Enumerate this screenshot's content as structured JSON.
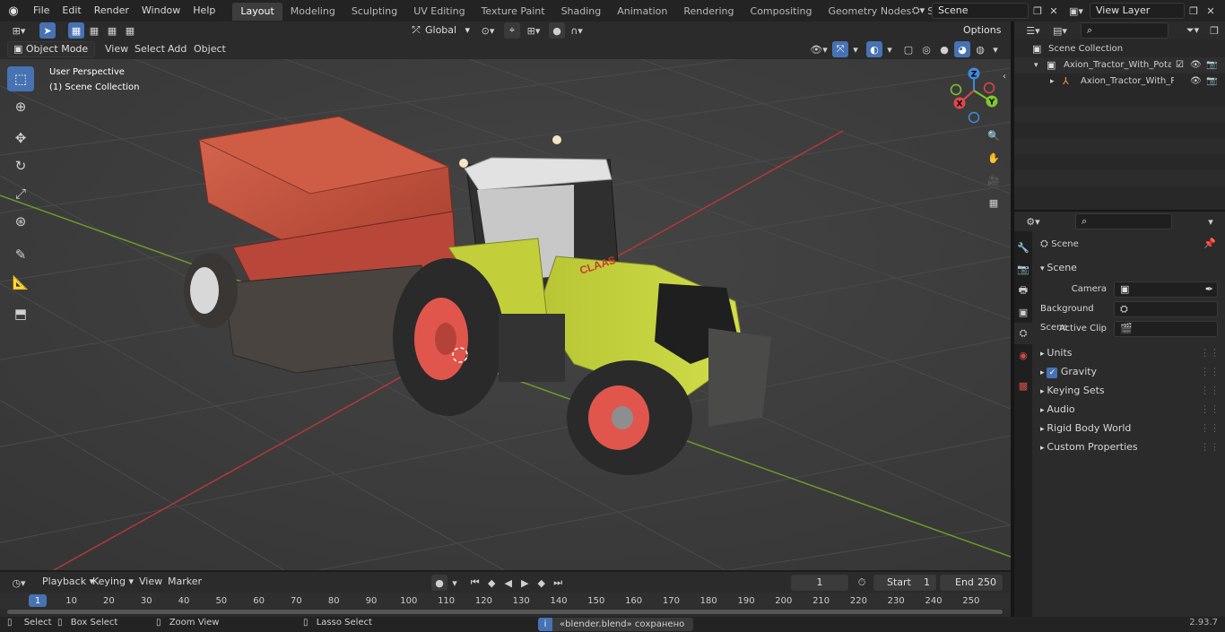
{
  "menu": [
    "File",
    "Edit",
    "Render",
    "Window",
    "Help"
  ],
  "workspaces": [
    "Layout",
    "Modeling",
    "Sculpting",
    "UV Editing",
    "Texture Paint",
    "Shading",
    "Animation",
    "Rendering",
    "Compositing",
    "Geometry Nodes",
    "Scripting"
  ],
  "active_workspace": "Layout",
  "scene_selector": "Scene",
  "view_layer_selector": "View Layer",
  "header": {
    "transform_orientation": "Global",
    "options_label": "Options",
    "mode": "Object Mode",
    "view_menu": "View",
    "select_menu": "Select",
    "add_menu": "Add",
    "object_menu": "Object"
  },
  "viewport": {
    "perspective_label": "User Perspective",
    "collection_label": "(1) Scene Collection",
    "gizmo_axes": [
      "X",
      "Y",
      "Z"
    ],
    "object_text": "CLAAS"
  },
  "outliner": {
    "root": "Scene Collection",
    "items": [
      {
        "label": "Axion_Tractor_With_Potato_P",
        "depth": 1
      },
      {
        "label": "Axion_Tractor_With_Pota",
        "depth": 2
      }
    ]
  },
  "properties": {
    "context": "Scene",
    "section": "Scene",
    "fields": [
      {
        "label": "Camera",
        "value": ""
      },
      {
        "label": "Background Scene",
        "value": ""
      },
      {
        "label": "Active Clip",
        "value": ""
      }
    ],
    "panels": [
      "Units",
      "Gravity",
      "Keying Sets",
      "Audio",
      "Rigid Body World",
      "Custom Properties"
    ],
    "gravity_checked": true
  },
  "timeline": {
    "playback": "Playback",
    "keying": "Keying",
    "view": "View",
    "marker": "Marker",
    "current_frame": "1",
    "start_label": "Start",
    "start_value": "1",
    "end_label": "End",
    "end_value": "250",
    "ticks": [
      "1",
      "10",
      "20",
      "30",
      "40",
      "50",
      "60",
      "70",
      "80",
      "90",
      "100",
      "110",
      "120",
      "130",
      "140",
      "150",
      "160",
      "170",
      "180",
      "190",
      "200",
      "210",
      "220",
      "230",
      "240",
      "250"
    ]
  },
  "status": {
    "select": "Select",
    "box_select": "Box Select",
    "zoom_view": "Zoom View",
    "lasso_select": "Lasso Select",
    "message": "«blender.blend» сохранено",
    "version": "2.93.7"
  },
  "colors": {
    "accent": "#4772b3",
    "x_axis": "#e0474c",
    "y_axis": "#82c52d",
    "z_axis": "#3f8bdb",
    "tractor_body": "#c3d13a",
    "rims": "#e0564d",
    "hopper": "#d1563f"
  }
}
